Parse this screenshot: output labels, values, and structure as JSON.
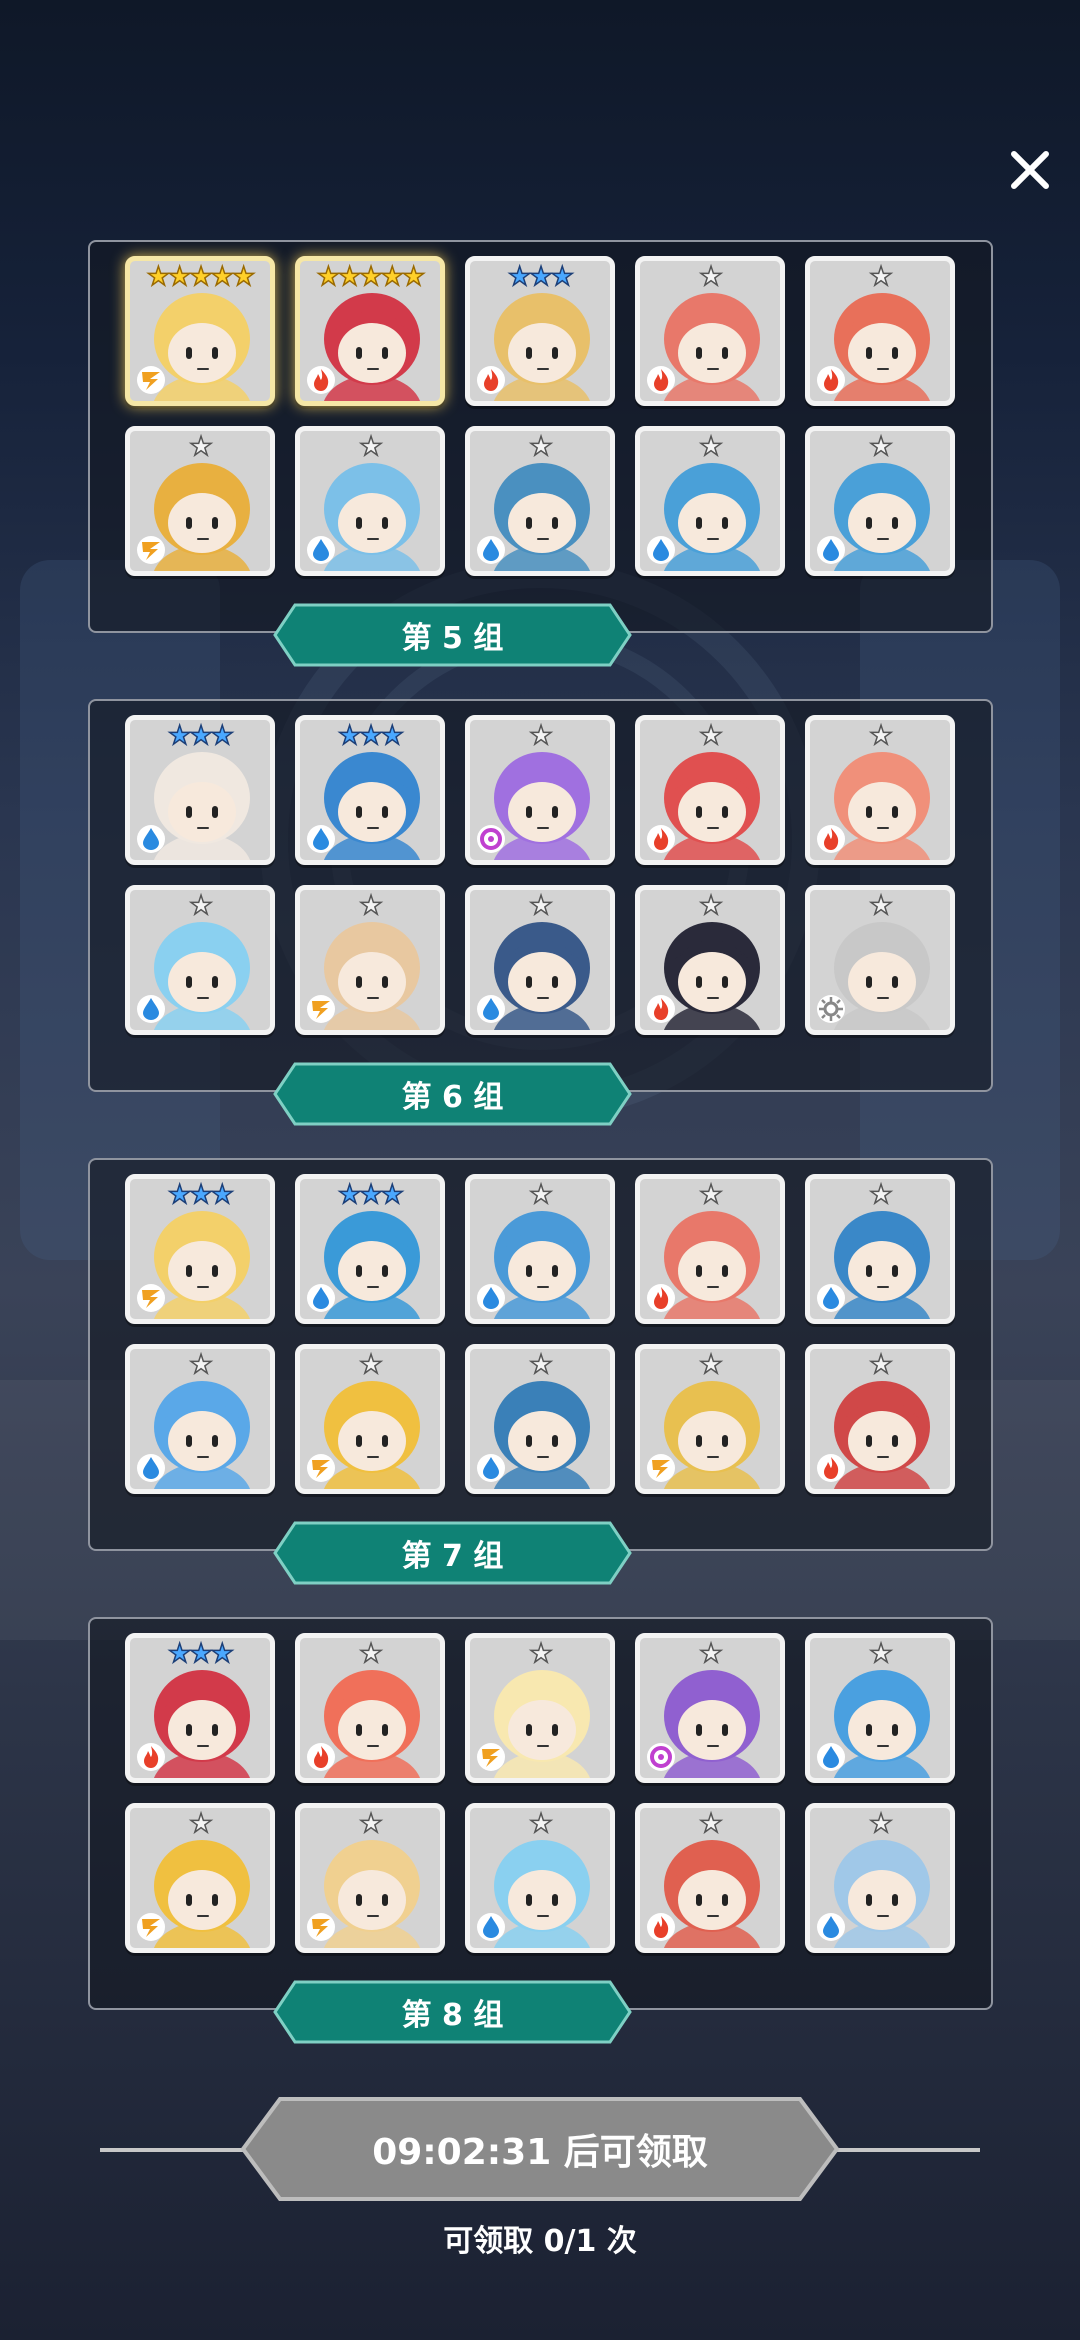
{
  "theme": {
    "accent": "#0f8275",
    "button_gray": "#8a8a8a",
    "card_bg": "#d3d3d3"
  },
  "close_icon": "close-icon",
  "groups": [
    {
      "label": "第 5 组",
      "heroes": [
        {
          "hair": "#f3d06a",
          "element": "lightning",
          "stars": 5,
          "tier": "gold"
        },
        {
          "hair": "#d23a4a",
          "element": "fire",
          "stars": 5,
          "tier": "gold"
        },
        {
          "hair": "#e8c06a",
          "element": "fire",
          "stars": 3,
          "tier": "blue"
        },
        {
          "hair": "#e8786a",
          "element": "fire",
          "stars": 1,
          "tier": "gray"
        },
        {
          "hair": "#e8705a",
          "element": "fire",
          "stars": 1,
          "tier": "gray"
        },
        {
          "hair": "#e8b040",
          "element": "lightning",
          "stars": 1,
          "tier": "gray"
        },
        {
          "hair": "#7cc0e8",
          "element": "water",
          "stars": 1,
          "tier": "gray"
        },
        {
          "hair": "#4a90c0",
          "element": "water",
          "stars": 1,
          "tier": "gray"
        },
        {
          "hair": "#4aa0d8",
          "element": "water",
          "stars": 1,
          "tier": "gray"
        },
        {
          "hair": "#4aa0d8",
          "element": "water",
          "stars": 1,
          "tier": "gray"
        }
      ]
    },
    {
      "label": "第 6 组",
      "heroes": [
        {
          "hair": "#f0e8e0",
          "element": "water",
          "stars": 3,
          "tier": "blue"
        },
        {
          "hair": "#3a88d0",
          "element": "water",
          "stars": 3,
          "tier": "blue"
        },
        {
          "hair": "#a070e0",
          "element": "arcane",
          "stars": 1,
          "tier": "gray"
        },
        {
          "hair": "#e05050",
          "element": "fire",
          "stars": 1,
          "tier": "gray"
        },
        {
          "hair": "#f0907a",
          "element": "fire",
          "stars": 1,
          "tier": "gray"
        },
        {
          "hair": "#8ad0f0",
          "element": "water",
          "stars": 1,
          "tier": "gray"
        },
        {
          "hair": "#e8c8a0",
          "element": "lightning",
          "stars": 1,
          "tier": "gray"
        },
        {
          "hair": "#3a5a8a",
          "element": "water",
          "stars": 1,
          "tier": "gray"
        },
        {
          "hair": "#2a2a3a",
          "element": "fire",
          "stars": 1,
          "tier": "gray"
        },
        {
          "hair": "#c8c8c8",
          "element": "light",
          "stars": 1,
          "tier": "gray"
        }
      ]
    },
    {
      "label": "第 7 组",
      "heroes": [
        {
          "hair": "#f3d06a",
          "element": "lightning",
          "stars": 3,
          "tier": "blue"
        },
        {
          "hair": "#3a9ad8",
          "element": "water",
          "stars": 3,
          "tier": "blue"
        },
        {
          "hair": "#4a9ad8",
          "element": "water",
          "stars": 1,
          "tier": "gray"
        },
        {
          "hair": "#e8786a",
          "element": "fire",
          "stars": 1,
          "tier": "gray"
        },
        {
          "hair": "#3a88c8",
          "element": "water",
          "stars": 1,
          "tier": "gray"
        },
        {
          "hair": "#5aa8e8",
          "element": "water",
          "stars": 1,
          "tier": "gray"
        },
        {
          "hair": "#f0c040",
          "element": "lightning",
          "stars": 1,
          "tier": "gray"
        },
        {
          "hair": "#3a80b8",
          "element": "water",
          "stars": 1,
          "tier": "gray"
        },
        {
          "hair": "#e8c050",
          "element": "lightning",
          "stars": 1,
          "tier": "gray"
        },
        {
          "hair": "#d04848",
          "element": "fire",
          "stars": 1,
          "tier": "gray"
        }
      ]
    },
    {
      "label": "第 8 组",
      "heroes": [
        {
          "hair": "#d23a4a",
          "element": "fire",
          "stars": 3,
          "tier": "blue"
        },
        {
          "hair": "#f0705a",
          "element": "fire",
          "stars": 1,
          "tier": "gray"
        },
        {
          "hair": "#f8e8b0",
          "element": "lightning",
          "stars": 1,
          "tier": "gray"
        },
        {
          "hair": "#9060d0",
          "element": "arcane",
          "stars": 1,
          "tier": "gray"
        },
        {
          "hair": "#4aa0e0",
          "element": "water",
          "stars": 1,
          "tier": "gray"
        },
        {
          "hair": "#f0c040",
          "element": "lightning",
          "stars": 1,
          "tier": "gray"
        },
        {
          "hair": "#f0d090",
          "element": "lightning",
          "stars": 1,
          "tier": "gray"
        },
        {
          "hair": "#8ad0f0",
          "element": "water",
          "stars": 1,
          "tier": "gray"
        },
        {
          "hair": "#e06050",
          "element": "fire",
          "stars": 1,
          "tier": "gray"
        },
        {
          "hair": "#a0c8e8",
          "element": "water",
          "stars": 1,
          "tier": "gray"
        }
      ]
    }
  ],
  "claim": {
    "button_label": "09:02:31 后可领取",
    "count_text": "可领取 0/1 次"
  }
}
